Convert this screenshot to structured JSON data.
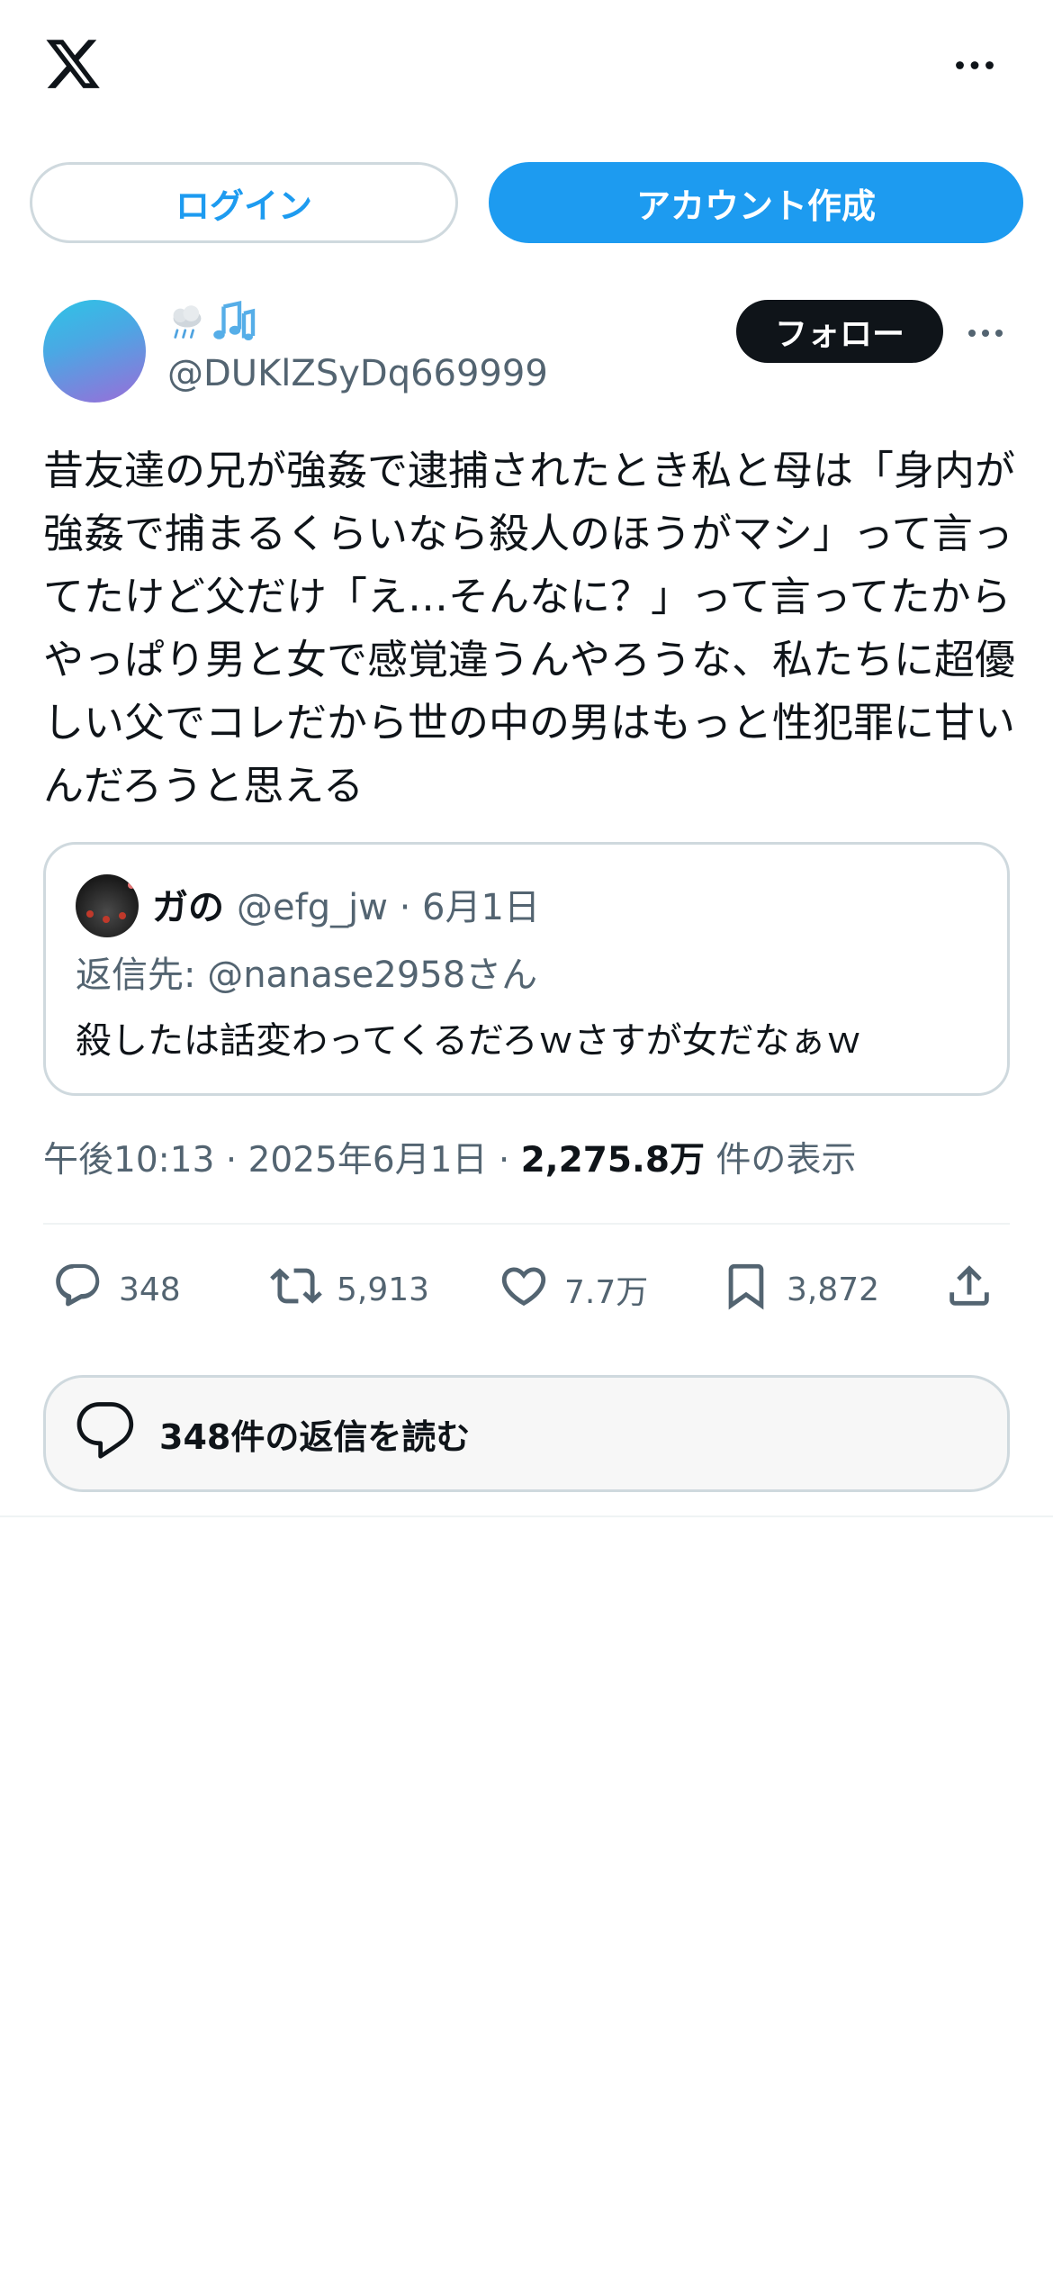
{
  "header": {
    "logo_icon": "x-logo-icon",
    "more_icon": "more-horizontal-icon"
  },
  "auth": {
    "login_label": "ログイン",
    "signup_label": "アカウント作成"
  },
  "tweet": {
    "display_name_emoji": "🌧️🎶",
    "handle": "@DUKlZSyDq669999",
    "follow_label": "フォロー",
    "text": "昔友達の兄が強姦で逮捕されたとき私と母は「身内が強姦で捕まるくらいなら殺人のほうがマシ」って言ってたけど父だけ「え…そんなに？」って言ってたからやっぱり男と女で感覚違うんやろうな、私たちに超優しい父でコレだから世の中の男はもっと性犯罪に甘いんだろうと思える",
    "quote": {
      "name": "ガの",
      "handle_date": "@efg_jw · 6月1日",
      "reply_to": "返信先: @nanase2958さん",
      "text": "殺したは話変わってくるだろｗさすが女だなぁｗ"
    },
    "time": "午後10:13 · 2025年6月1日 · ",
    "views_count": "2,275.8万",
    "views_label": " 件の表示",
    "actions": {
      "replies": "348",
      "retweets": "5,913",
      "likes": "7.7万",
      "bookmarks": "3,872"
    },
    "read_replies_label": "348件の返信を読む"
  },
  "colors": {
    "accent": "#1d9bf0",
    "text_primary": "#0f1419",
    "text_secondary": "#536471",
    "border": "#cfd9de"
  }
}
